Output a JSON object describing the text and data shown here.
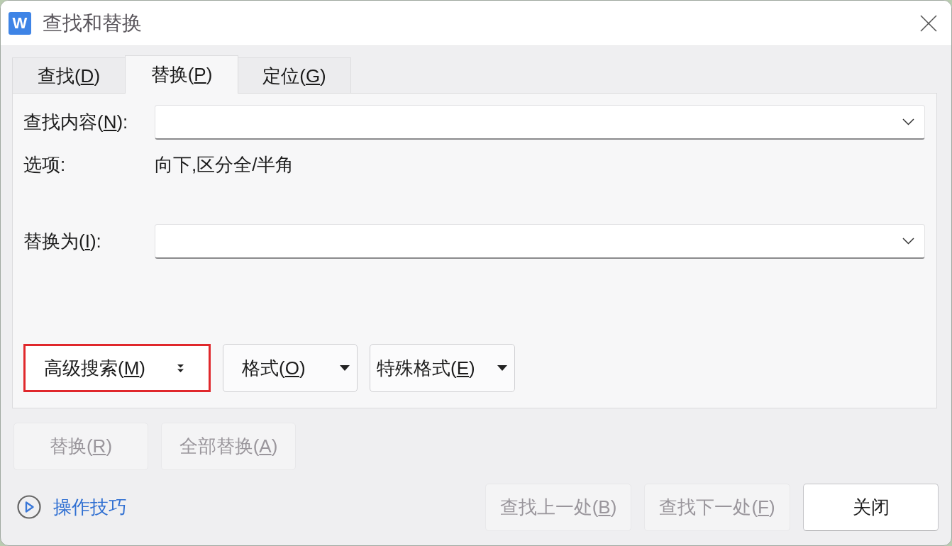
{
  "window": {
    "logo_letter": "W",
    "title": "查找和替换"
  },
  "tabs": [
    {
      "label": "查找(",
      "access_key": "D",
      "label_end": ")",
      "selected": false
    },
    {
      "label": "替换(",
      "access_key": "P",
      "label_end": ")",
      "selected": true
    },
    {
      "label": "定位(",
      "access_key": "G",
      "label_end": ")",
      "selected": false
    }
  ],
  "find_field": {
    "label": "查找内容(",
    "access_key": "N",
    "label_end": "):"
  },
  "options": {
    "label": "选项:",
    "value": "向下,区分全/半角"
  },
  "replace_field": {
    "label": "替换为(",
    "access_key": "I",
    "label_end": "):"
  },
  "format_buttons": [
    {
      "kind": "expander",
      "label": "高级搜索(",
      "access_key": "M",
      "label_end": ")",
      "highlighted": true
    },
    {
      "kind": "dropdown",
      "label": "格式(",
      "access_key": "O",
      "label_end": ")",
      "highlighted": false
    },
    {
      "kind": "dropdown",
      "label": "特殊格式(",
      "access_key": "E",
      "label_end": ")",
      "highlighted": false
    }
  ],
  "replace_buttons": [
    {
      "label": "替换(",
      "access_key": "R",
      "label_end": ")",
      "disabled": true
    },
    {
      "label": "全部替换(",
      "access_key": "A",
      "label_end": ")",
      "disabled": true
    }
  ],
  "help_link": {
    "label": "操作技巧"
  },
  "footer_buttons": [
    {
      "label": "查找上一处(",
      "access_key": "B",
      "label_end": ")",
      "disabled": true
    },
    {
      "label": "查找下一处(",
      "access_key": "F",
      "label_end": ")",
      "disabled": true
    },
    {
      "label": "关闭",
      "disabled": false
    }
  ]
}
